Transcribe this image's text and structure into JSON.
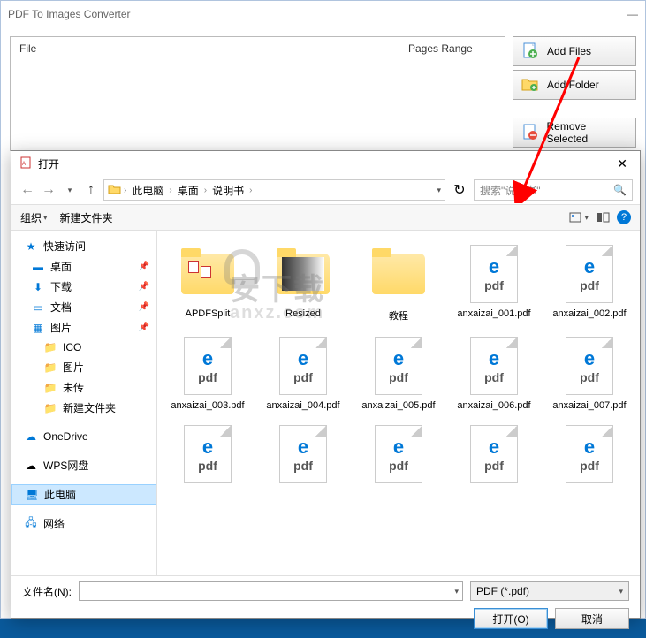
{
  "app": {
    "title": "PDF To Images Converter",
    "file_header": "File",
    "pages_header": "Pages Range",
    "add_files": "Add Files",
    "add_folder": "Add Folder",
    "remove_selected": "Remove Selected"
  },
  "dialog": {
    "title": "打开",
    "breadcrumbs": [
      "此电脑",
      "桌面",
      "说明书"
    ],
    "search_placeholder": "搜索\"说明书\"",
    "organize": "组织",
    "new_folder": "新建文件夹",
    "tree": {
      "quick_access": "快速访问",
      "desktop": "桌面",
      "downloads": "下载",
      "documents": "文档",
      "pictures": "图片",
      "ico": "ICO",
      "pictures2": "图片",
      "unnamed": "未传",
      "newfolder": "新建文件夹",
      "onedrive": "OneDrive",
      "wps": "WPS网盘",
      "thispc": "此电脑",
      "network": "网络"
    },
    "files": [
      {
        "type": "folder",
        "name": "APDFSplit"
      },
      {
        "type": "folder",
        "name": "Resized"
      },
      {
        "type": "folder",
        "name": "教程"
      },
      {
        "type": "pdf",
        "name": "anxaizai_001.pdf"
      },
      {
        "type": "pdf",
        "name": "anxaizai_002.pdf"
      },
      {
        "type": "pdf",
        "name": "anxaizai_003.pdf"
      },
      {
        "type": "pdf",
        "name": "anxaizai_004.pdf"
      },
      {
        "type": "pdf",
        "name": "anxaizai_005.pdf"
      },
      {
        "type": "pdf",
        "name": "anxaizai_006.pdf"
      },
      {
        "type": "pdf",
        "name": "anxaizai_007.pdf"
      },
      {
        "type": "pdf",
        "name": ""
      },
      {
        "type": "pdf",
        "name": ""
      },
      {
        "type": "pdf",
        "name": ""
      },
      {
        "type": "pdf",
        "name": ""
      },
      {
        "type": "pdf",
        "name": ""
      }
    ],
    "filename_label": "文件名(N):",
    "filter": "PDF (*.pdf)",
    "open_btn": "打开(O)",
    "cancel_btn": "取消"
  },
  "watermark": "安下载"
}
